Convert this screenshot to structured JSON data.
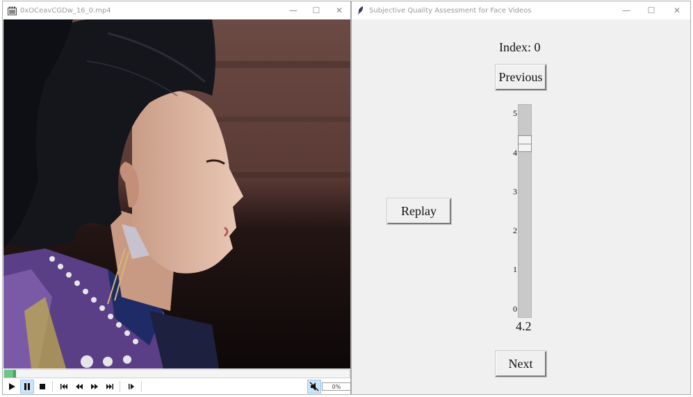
{
  "player": {
    "title": "0xOCeavCGDw_16_0.mp4",
    "progress_fraction": 0.03,
    "volume_text": "0%"
  },
  "assessment": {
    "title": "Subjective Quality Assessment for Face Videos",
    "index_label": "Index: 0",
    "previous_label": "Previous",
    "replay_label": "Replay",
    "next_label": "Next",
    "scale": {
      "ticks": [
        "5",
        "4",
        "3",
        "2",
        "1",
        "0"
      ],
      "min": 0,
      "max": 5,
      "value": 4.2,
      "value_text": "4.2"
    }
  },
  "window_controls": {
    "minimize": "—",
    "maximize": "☐",
    "close": "✕"
  }
}
